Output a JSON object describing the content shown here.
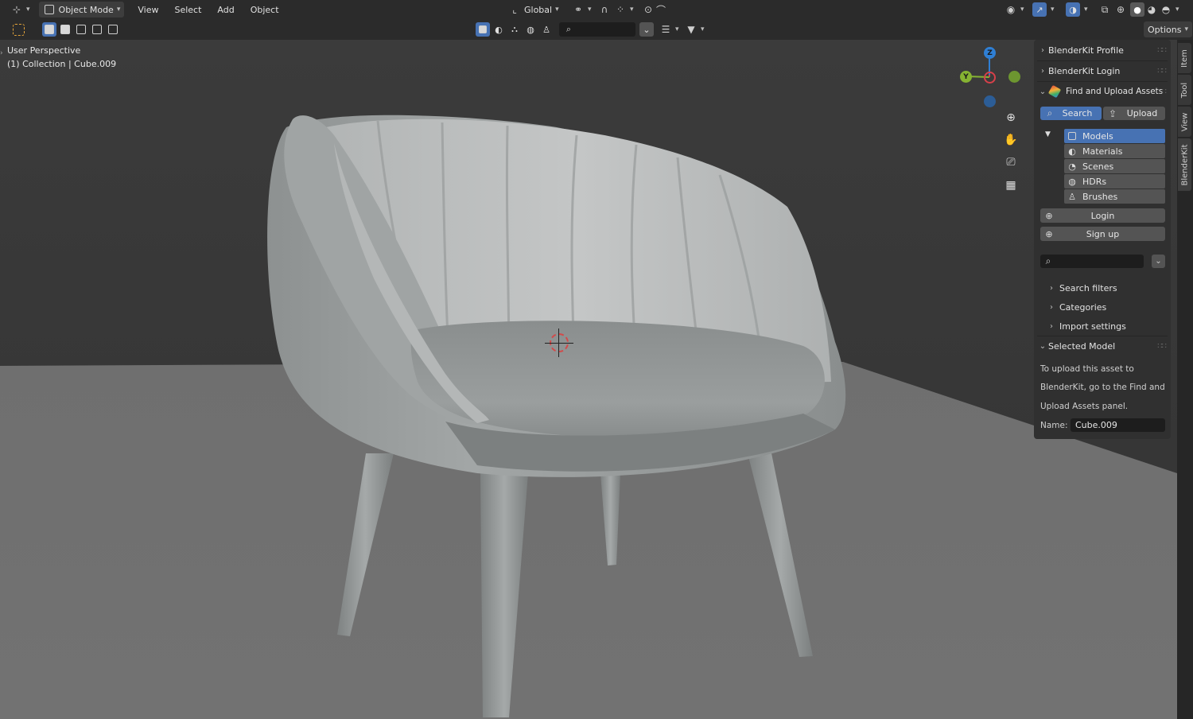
{
  "header": {
    "mode_label": "Object Mode",
    "menus": [
      "View",
      "Select",
      "Add",
      "Object"
    ],
    "transform_orientation": "Global",
    "options_label": "Options"
  },
  "viewport": {
    "perspective_label": "User Perspective",
    "collection_label": "(1) Collection | Cube.009",
    "gizmo": {
      "z": "Z",
      "y": "Y"
    },
    "colors": {
      "x": "#d7404a",
      "y": "#86b332",
      "z": "#2f7fd4",
      "accent": "#4772b3"
    }
  },
  "npanel": {
    "profile_label": "BlenderKit Profile",
    "login_panel_label": "BlenderKit Login",
    "find_upload_label": "Find and Upload Assets",
    "search_tab": "Search",
    "upload_tab": "Upload",
    "categories": [
      {
        "label": "Models",
        "selected": true
      },
      {
        "label": "Materials",
        "selected": false
      },
      {
        "label": "Scenes",
        "selected": false
      },
      {
        "label": "HDRs",
        "selected": false
      },
      {
        "label": "Brushes",
        "selected": false
      }
    ],
    "login_button": "Login",
    "signup_button": "Sign up",
    "search_placeholder": "",
    "search_filters_label": "Search filters",
    "categories_label": "Categories",
    "import_settings_label": "Import settings",
    "selected_model_label": "Selected Model",
    "upload_help": [
      "To upload this asset to",
      "BlenderKit, go to the Find and",
      "Upload Assets panel."
    ],
    "name_label": "Name:",
    "name_value": "Cube.009"
  },
  "side_tabs": [
    "Item",
    "Tool",
    "View",
    "BlenderKit"
  ]
}
